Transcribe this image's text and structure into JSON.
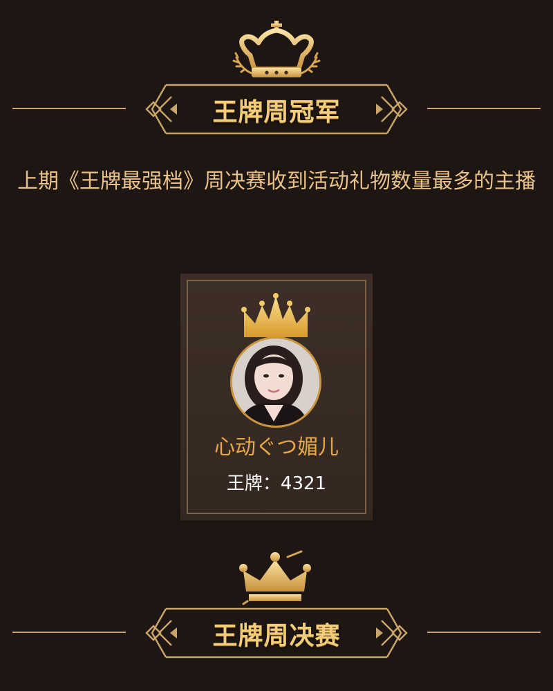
{
  "section1": {
    "title": "王牌周冠军",
    "description": "上期《王牌最强档》周决赛收到活动礼物数量最多的主播",
    "crown_icon": "crown-icon"
  },
  "winner": {
    "name": "心动ぐつ媚儿",
    "score_label": "王牌：",
    "score_value": "4321",
    "score_text": "王牌：4321",
    "avatar_icon": "avatar"
  },
  "section2": {
    "title": "王牌周决赛",
    "crown_icon": "crown-icon"
  },
  "colors": {
    "background": "#1e1612",
    "gold": "#c9a56a",
    "title_gold": "#f1cd7c",
    "text_gold": "#e8c28a",
    "name_orange": "#e5a84a"
  }
}
